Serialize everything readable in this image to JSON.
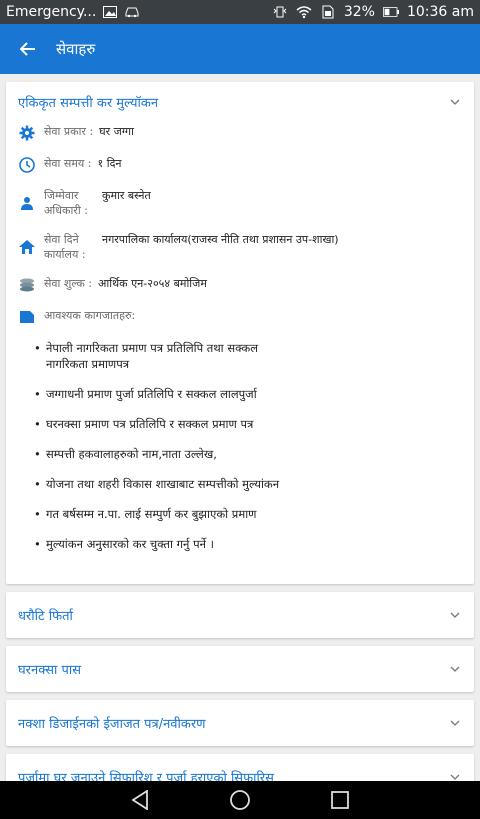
{
  "status": {
    "notification": "Emergency...",
    "battery": "32%",
    "time": "10:36 am"
  },
  "appbar": {
    "title": "सेवाहरु"
  },
  "expanded_card": {
    "title": "एकिकृत सम्पत्ती कर मुल्यॉकन",
    "fields": [
      {
        "icon": "gear-icon",
        "label": "सेवा प्रकार :",
        "value": "घर जग्गा"
      },
      {
        "icon": "clock-icon",
        "label": "सेवा समय :",
        "value": "१ दिन"
      },
      {
        "icon": "person-icon",
        "label": "जिम्मेवार अधिकारी :",
        "value": "कुमार बस्नेत"
      },
      {
        "icon": "home-icon",
        "label": "सेवा दिने कार्यालय :",
        "value": "नगरपालिका कार्यालय(राजस्व नीति तथा प्रशासन उप-शाखा)"
      },
      {
        "icon": "coins-icon",
        "label": "सेवा शुल्क :",
        "value": "आर्थिक एन-२०५४ बमोजिम"
      }
    ],
    "docs_label": "आवश्यक कागजातहरु:",
    "docs": [
      "नेपाली नागरिकता प्रमाण पत्र प्रतिलिपि तथा सक्कल नागरिकता प्रमाणपत्र",
      "जग्गाधनी प्रमाण पुर्जा प्रतिलिपि र सक्कल लालपुर्जा",
      "घरनक्सा प्रमाण पत्र प्रतिलिपि र सक्कल प्रमाण पत्र",
      "सम्पत्ती हकवालाहरुको नाम,नाता उल्लेख,",
      "योजना तथा शहरी विकास शाखाबाट सम्पत्तीको मुल्यांकन",
      "गत बर्षसम्म न.पा. लाई सम्पुर्ण कर बुझाएको प्रमाण",
      "मुल्यांकन अनुसारको कर चुक्ता गर्नु पर्ने ।"
    ]
  },
  "collapsed_cards": [
    "धरौटि फिर्ता",
    "घरनक्सा पास",
    "नक्शा डिजाईनको ईजाजत पत्र/नवीकरण",
    "पुर्जामा घर जनाउने सिफारिश र पुर्जा हराएको सिफारिस"
  ],
  "colors": {
    "primary": "#1976d2",
    "statusbar": "#3a3f44",
    "background": "#eeeeee"
  }
}
